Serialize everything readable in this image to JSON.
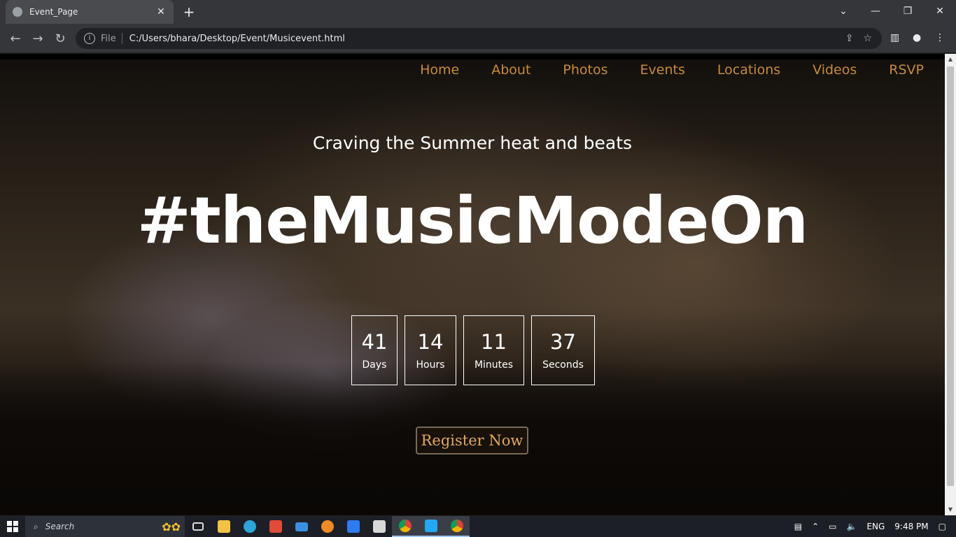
{
  "browser": {
    "tab_title": "Event_Page",
    "new_tab": "+",
    "scheme_label": "File",
    "url": "C:/Users/bhara/Desktop/Event/Musicevent.html"
  },
  "site": {
    "nav": [
      "Home",
      "About",
      "Photos",
      "Events",
      "Locations",
      "Videos",
      "RSVP"
    ],
    "tagline": "Craving the Summer heat and beats",
    "hashtag": "#theMusicModeOn",
    "countdown": [
      {
        "value": "41",
        "label": "Days"
      },
      {
        "value": "14",
        "label": "Hours"
      },
      {
        "value": "11",
        "label": "Minutes"
      },
      {
        "value": "37",
        "label": "Seconds"
      }
    ],
    "register_label": "Register Now",
    "nav_color": "#c98a3e"
  },
  "taskbar": {
    "search_placeholder": "Search",
    "language": "ENG",
    "time": "9:48 PM"
  }
}
